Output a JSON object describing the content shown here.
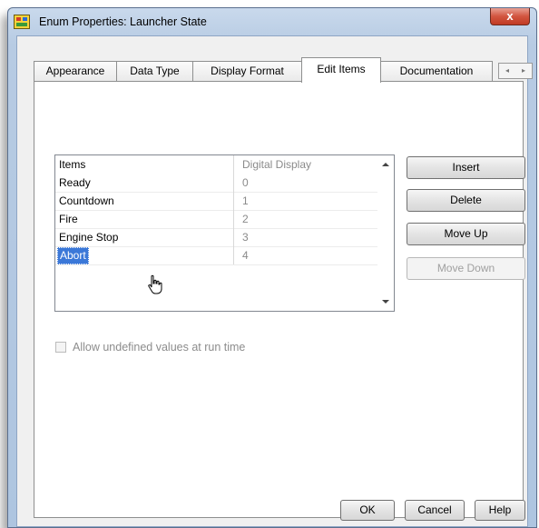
{
  "window": {
    "title": "Enum Properties: Launcher State",
    "icon": "labview-vi-icon",
    "close_label": "x"
  },
  "tabs": [
    {
      "label": "Appearance",
      "active": false
    },
    {
      "label": "Data Type",
      "active": false
    },
    {
      "label": "Display Format",
      "active": false
    },
    {
      "label": "Edit Items",
      "active": true
    },
    {
      "label": "Documentation",
      "active": false
    }
  ],
  "tab_scroll": {
    "left": "◂",
    "right": "▸"
  },
  "items_table": {
    "headers": {
      "items": "Items",
      "digital_display": "Digital Display"
    },
    "rows": [
      {
        "item": "Ready",
        "value": "0"
      },
      {
        "item": "Countdown",
        "value": "1"
      },
      {
        "item": "Fire",
        "value": "2"
      },
      {
        "item": "Engine Stop",
        "value": "3"
      },
      {
        "item": "Abort",
        "value": "4"
      }
    ],
    "selected_item": "Abort"
  },
  "actions": {
    "insert": "Insert",
    "delete": "Delete",
    "move_up": "Move Up",
    "move_down": "Move Down"
  },
  "allow_undefined": {
    "label": "Allow undefined values at run time",
    "checked": false
  },
  "footer": {
    "ok": "OK",
    "cancel": "Cancel",
    "help": "Help"
  },
  "colors": {
    "selection": "#3b78d8",
    "close_button": "#c9432e"
  }
}
